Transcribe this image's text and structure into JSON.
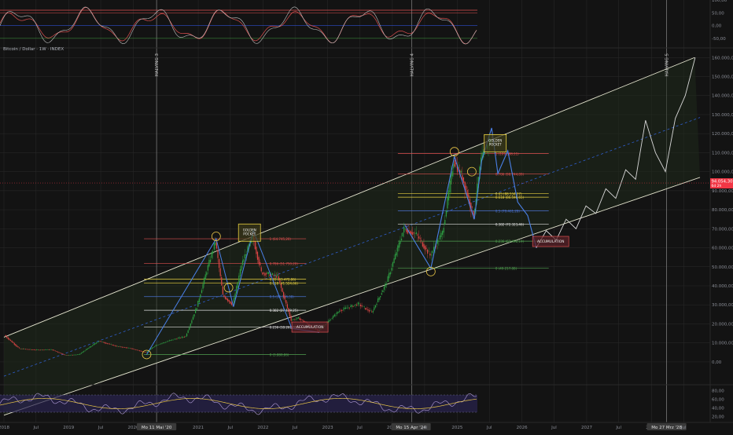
{
  "symbol_title": "Bitcoin / Dollar · 1W · INDEX",
  "colors": {
    "background": "#131313",
    "grid": "#2a2a2a",
    "channel": "#e6e6d0",
    "midline": "#2f5fd0",
    "zigzag": "#4a80e8",
    "projection": "#d8d8d8",
    "fib_red": "#e05050",
    "fib_yellow": "#e8d040",
    "fib_blue": "#4a70d0",
    "fib_white": "#e0e0e0",
    "fib_green": "#50a050",
    "candle_up": "#2ea043",
    "candle_down": "#e04545",
    "price_tag": "#f23645",
    "oscillator_line": "#c0c0c0",
    "rsi_line": "#b39ddb",
    "rsi_ma": "#e8c547"
  },
  "halvings": [
    {
      "label": "HALVING 3",
      "date": "2020-05-11"
    },
    {
      "label": "HALVING 4",
      "date": "2024-04-19"
    },
    {
      "label": "HALVING 5",
      "date": "2028-03-27"
    }
  ],
  "x_axis": {
    "labels": [
      "2018",
      "Jul",
      "2019",
      "Jul",
      "2020",
      "Mo 11 Mai '20",
      "2021",
      "Jul",
      "2022",
      "Jul",
      "2023",
      "Jul",
      "2024",
      "Mo 15 Apr '24",
      "Jul",
      "2025",
      "Jul",
      "2026",
      "Jul",
      "2027",
      "Jul",
      "2028",
      "Mo 27 Mrz '28",
      "Jul"
    ]
  },
  "y_axis": {
    "ticks": [
      "160.000,00",
      "150.000,00",
      "140.000,00",
      "130.000,00",
      "120.000,00",
      "110.000,00",
      "100.000,00",
      "90.000,00",
      "80.000,00",
      "70.000,00",
      "60.000,00",
      "50.000,00",
      "40.000,00",
      "30.000,00",
      "20.000,00",
      "10.000,00",
      "0,00"
    ],
    "range": [
      -12000,
      163000
    ]
  },
  "price_tag": {
    "value": "94.054,30",
    "sub": "6d 2h"
  },
  "fib_2021": {
    "levels": [
      {
        "text": "1 (64.745,20)",
        "price": 64745,
        "color": "red"
      },
      {
        "text": "0.786 (51.750,20)",
        "price": 51750,
        "color": "red"
      },
      {
        "text": "0.65 (43.472,86)",
        "price": 43473,
        "color": "yellow"
      },
      {
        "text": "0.618 (41.524,66)",
        "price": 41525,
        "color": "yellow"
      },
      {
        "text": "0.5 (34.336,38)",
        "price": 34336,
        "color": "blue"
      },
      {
        "text": "0.382 (27.149,25)",
        "price": 27149,
        "color": "white"
      },
      {
        "text": "0.236 (18.261,89)",
        "price": 18262,
        "color": "white"
      },
      {
        "text": "0 (3.880,86)",
        "price": 3881,
        "color": "green"
      }
    ]
  },
  "fib_2025": {
    "levels": [
      {
        "text": "1 (109.588,11)",
        "price": 109588,
        "color": "red"
      },
      {
        "text": "0.786 (98.744,89)",
        "price": 98745,
        "color": "red"
      },
      {
        "text": "0.65 (88.534,27)",
        "price": 88534,
        "color": "yellow"
      },
      {
        "text": "0.618 (86.598,65)",
        "price": 86599,
        "color": "yellow"
      },
      {
        "text": "0.5 (79.461,28)",
        "price": 79461,
        "color": "blue"
      },
      {
        "text": "0.382 (72.323,46)",
        "price": 72323,
        "color": "white"
      },
      {
        "text": "0.236 (63.492,19)",
        "price": 63492,
        "color": "green"
      },
      {
        "text": "0 (49.217,88)",
        "price": 49218,
        "color": "green"
      }
    ]
  },
  "annotations": {
    "golden_pocket": "GOLDEN\nPOCKET",
    "accumulation": "ACCUMULATION"
  },
  "oscillator": {
    "ticks": [
      "100,00",
      "50,00",
      "0,00",
      "-50,00"
    ]
  },
  "rsi": {
    "ticks": [
      "80,00",
      "60,00",
      "40,00",
      "20,00"
    ]
  },
  "chart_data": {
    "type": "line",
    "title": "Bitcoin / Dollar · 1W · INDEX",
    "x_unit": "date",
    "ylim": [
      -12000,
      163000
    ],
    "series": [
      {
        "kind": "price",
        "x": [
          "2018-01-08",
          "2018-04-02",
          "2018-07-02",
          "2018-10-01",
          "2018-12-17",
          "2019-03-04",
          "2019-06-24",
          "2019-09-30",
          "2019-12-16",
          "2020-03-16",
          "2020-05-11",
          "2020-08-10",
          "2020-10-26",
          "2020-12-28",
          "2021-02-22",
          "2021-04-12",
          "2021-05-24",
          "2021-07-19",
          "2021-09-06",
          "2021-11-08",
          "2021-12-27",
          "2022-03-28",
          "2022-06-13",
          "2022-07-25",
          "2022-11-14",
          "2023-03-13",
          "2023-06-26",
          "2023-09-11",
          "2023-12-04",
          "2024-03-11",
          "2024-05-20",
          "2024-08-05",
          "2024-10-14",
          "2024-12-16",
          "2025-02-03",
          "2025-04-07",
          "2025-05-19",
          "2025-07-14"
        ],
        "y": [
          14000,
          7000,
          6300,
          6500,
          3500,
          3900,
          11000,
          8300,
          7200,
          5000,
          8800,
          11600,
          13500,
          29000,
          48000,
          63500,
          35000,
          30000,
          51000,
          66000,
          47000,
          45000,
          22000,
          23000,
          16300,
          27000,
          30500,
          26000,
          42000,
          70000,
          67000,
          56000,
          68000,
          106000,
          97000,
          77000,
          106000,
          118000
        ]
      },
      {
        "kind": "zigzag",
        "x": [
          "2020-03-16",
          "2021-04-12",
          "2021-07-19",
          "2021-11-08",
          "2022-06-13",
          "2022-11-14"
        ],
        "y": [
          3880,
          64745,
          29000,
          69000,
          17600,
          15500
        ]
      },
      {
        "kind": "zigzag",
        "x": [
          "2024-03-11",
          "2024-08-05",
          "2024-12-16",
          "2025-04-07",
          "2025-05-19",
          "2025-07-14",
          "2025-08-18",
          "2025-10-13",
          "2025-12-08",
          "2026-02-02",
          "2026-03-23"
        ],
        "y": [
          72000,
          49200,
          108000,
          75000,
          106000,
          123000,
          99000,
          111000,
          84000,
          77000,
          60000
        ]
      },
      {
        "kind": "projection",
        "x": [
          "2026-03-23",
          "2026-05-18",
          "2026-07-13",
          "2026-09-07",
          "2026-11-02",
          "2026-12-28",
          "2027-02-22",
          "2027-04-19",
          "2027-06-14",
          "2027-08-09",
          "2027-10-04",
          "2027-11-29",
          "2028-01-24",
          "2028-03-20",
          "2028-05-15",
          "2028-07-10",
          "2028-09-04"
        ],
        "y": [
          60000,
          69000,
          64000,
          75000,
          70000,
          82000,
          78000,
          91000,
          86000,
          101000,
          96000,
          127000,
          110000,
          100000,
          128000,
          140000,
          160000
        ]
      }
    ]
  }
}
